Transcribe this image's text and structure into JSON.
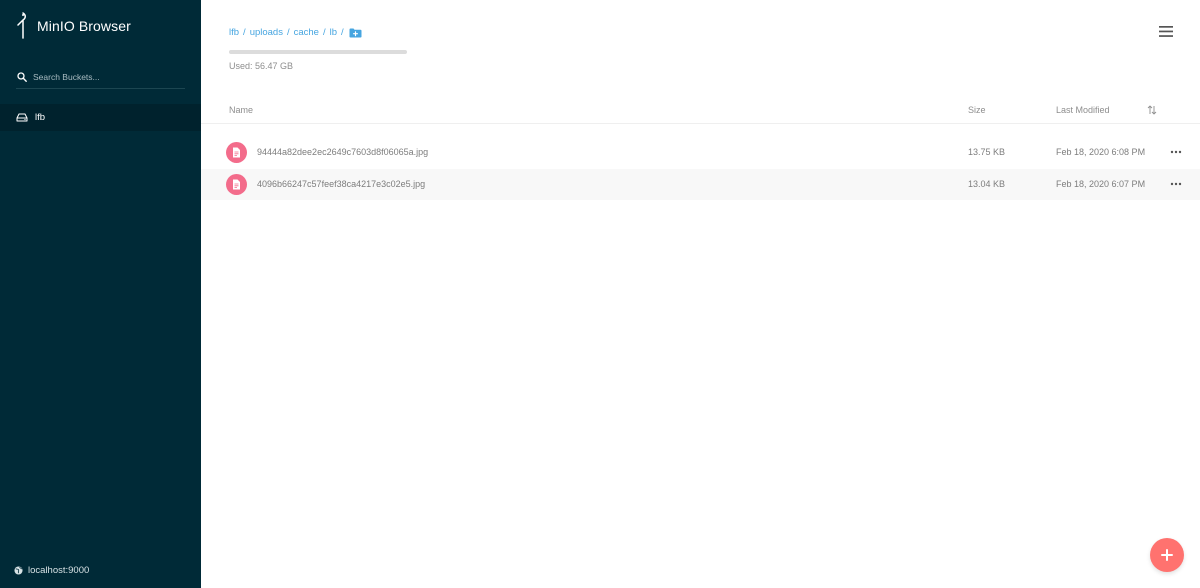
{
  "app": {
    "title": "MinIO Browser",
    "host": "localhost:9000"
  },
  "sidebar": {
    "search": {
      "placeholder": "Search Buckets..."
    },
    "buckets": [
      {
        "label": "lfb",
        "selected": true
      }
    ]
  },
  "main": {
    "breadcrumb": [
      "lfb",
      "uploads",
      "cache",
      "lb"
    ],
    "breadcrumb_separator": "/",
    "usage": {
      "text": "Used: 56.47 GB"
    },
    "columns": {
      "name": "Name",
      "size": "Size",
      "modified": "Last Modified"
    },
    "files": [
      {
        "name": "94444a82dee2ec2649c7603d8f06065a.jpg",
        "size": "13.75 KB",
        "modified": "Feb 18, 2020 6:08 PM"
      },
      {
        "name": "4096b66247c57feef38ca4217e3c02e5.jpg",
        "size": "13.04 KB",
        "modified": "Feb 18, 2020 6:07 PM"
      }
    ]
  },
  "icons": {
    "logo": "minio-logo-icon",
    "search": "search-icon",
    "bucket": "bucket-drive-icon",
    "globe": "globe-icon",
    "new_folder": "folder-plus-icon",
    "menu": "hamburger-menu-icon",
    "sort": "sort-icon",
    "file": "file-icon",
    "more": "more-horizontal-icon",
    "add": "plus-icon"
  },
  "colors": {
    "sidebar_bg": "#002a37",
    "link": "#46a5e0",
    "file_icon": "#f36c8b",
    "fab": "#ff726f"
  }
}
